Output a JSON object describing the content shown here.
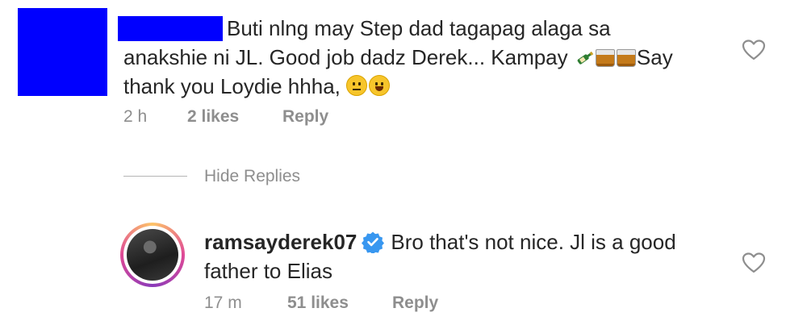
{
  "comment": {
    "text_line1": "Buti nlng may Step dad tagapag alaga sa",
    "text_line2": "anakshie  ni JL. Good job dadz Derek... Kampay",
    "text_line2_end": "Say",
    "text_line3": "thank you Loydie hhha,",
    "time": "2 h",
    "likes": "2 likes",
    "reply_label": "Reply",
    "emojis": [
      "bottle-emoji",
      "whisky-glass-emoji",
      "whisky-glass-emoji",
      "neutral-face-emoji",
      "laughing-face-emoji"
    ],
    "redacted_color": "#0000ff"
  },
  "hide_replies_label": "Hide Replies",
  "reply": {
    "username": "ramsayderek07",
    "text_part1": "Bro that's not nice. Jl is a good",
    "text_part2": "father to Elias",
    "time": "17 m",
    "likes": "51 likes",
    "reply_label": "Reply"
  },
  "colors": {
    "text": "#262626",
    "meta": "#8e8e8e",
    "verified": "#3897f0"
  }
}
